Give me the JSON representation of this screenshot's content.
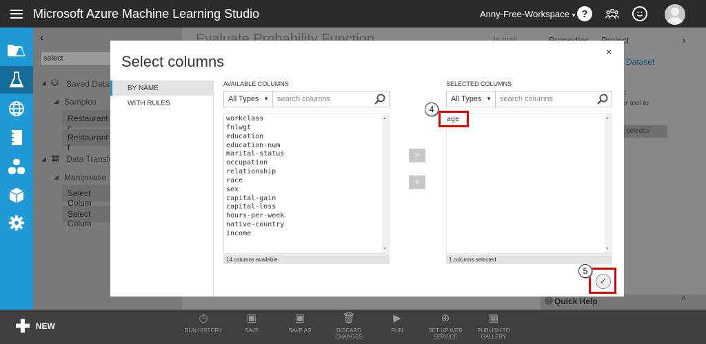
{
  "app": {
    "title": "Microsoft Azure Machine Learning Studio",
    "workspace": "Anny-Free-Workspace",
    "help_icon": "?"
  },
  "rail": {
    "icons": [
      "projects-icon",
      "experiments-icon",
      "web-services-icon",
      "notebooks-icon",
      "datasets-icon",
      "trained-models-icon",
      "settings-icon"
    ]
  },
  "background": {
    "collapse": "‹",
    "search_value": "select",
    "tree": {
      "saved_datasets": "Saved Datas",
      "samples": "Samples",
      "restaurant_1": "Restaurant c",
      "restaurant_2": "Restaurant f",
      "data_transform": "Data Transfo",
      "manipulation": "Manipulatio",
      "select_col_1": "Select Colum",
      "select_col_2": "Select Colum"
    },
    "canvas_title": "Evaluate Probability Function",
    "draft_status": "In draft",
    "props_tabs": [
      "Properties",
      "Project"
    ],
    "props_expand": "›",
    "props_dataset": "n Dataset",
    "props_colon": "s:",
    "props_hint": "or tool to",
    "props_selector": "n selector",
    "quick_help": "Quick Help",
    "quick_help_toggle": "^"
  },
  "bottombar": {
    "new_label": "NEW",
    "commands": [
      {
        "line1": "RUN HISTORY",
        "line2": "",
        "icon": "clock-icon",
        "glyph": "◷"
      },
      {
        "line1": "SAVE",
        "line2": "",
        "icon": "save-icon",
        "glyph": "▣"
      },
      {
        "line1": "SAVE AS",
        "line2": "",
        "icon": "save-as-icon",
        "glyph": "▣"
      },
      {
        "line1": "DISCARD",
        "line2": "CHANGES",
        "icon": "trash-icon",
        "glyph": "🗑"
      },
      {
        "line1": "RUN",
        "line2": "",
        "icon": "play-icon",
        "glyph": "▶"
      },
      {
        "line1": "SET UP WEB",
        "line2": "SERVICE",
        "icon": "web-service-icon",
        "glyph": "⊕"
      },
      {
        "line1": "PUBLISH TO",
        "line2": "GALLERY",
        "icon": "gallery-icon",
        "glyph": "▦"
      }
    ]
  },
  "dialog": {
    "title": "Select columns",
    "close": "×",
    "nav": [
      "BY NAME",
      "WITH RULES"
    ],
    "available": {
      "heading": "AVAILABLE COLUMNS",
      "type_filter": "All Types",
      "search_placeholder": "search columns",
      "items": [
        "workclass",
        "fnlwgt",
        "education",
        "education-num",
        "marital-status",
        "occupation",
        "relationship",
        "race",
        "sex",
        "capital-gain",
        "capital-loss",
        "hours-per-week",
        "native-country",
        "income"
      ],
      "footer": "14 columns available"
    },
    "add_button": ">",
    "remove_button": "<",
    "selected": {
      "heading": "SELECTED COLUMNS",
      "type_filter": "All Types",
      "search_placeholder": "search columns",
      "items": [
        "age"
      ],
      "footer": "1 columns selected"
    },
    "step_4": "4",
    "step_5": "5",
    "ok": "✓"
  },
  "colors": {
    "rail": "#1f9ad6",
    "topbar": "#2b2b2b",
    "highlight": "#e00000"
  }
}
